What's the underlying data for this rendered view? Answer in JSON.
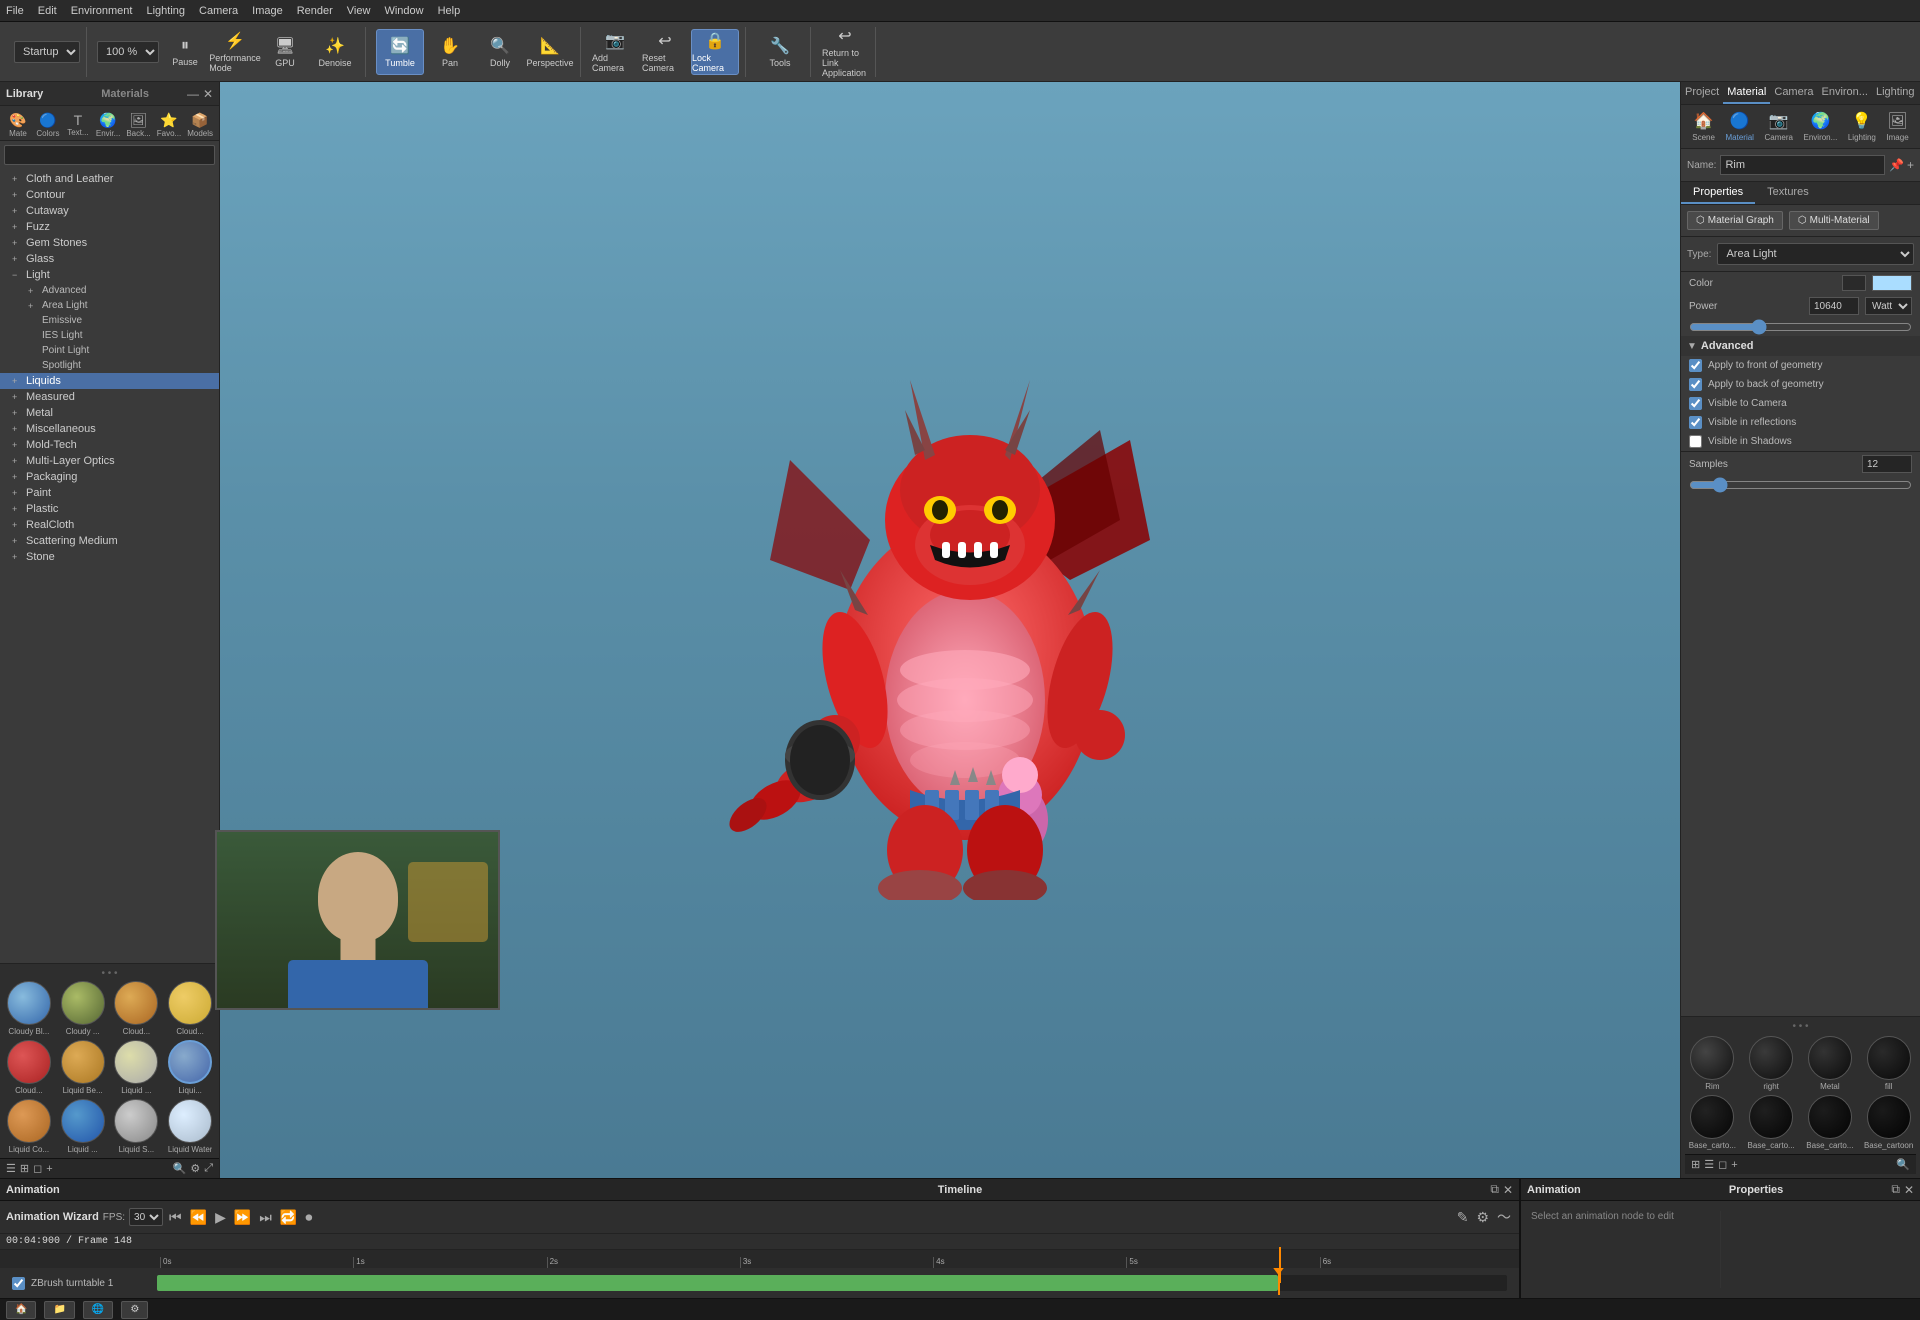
{
  "menubar": {
    "items": [
      "File",
      "Edit",
      "Environment",
      "Lighting",
      "Camera",
      "Image",
      "Render",
      "View",
      "Window",
      "Help"
    ]
  },
  "toolbar": {
    "startup_label": "Startup",
    "zoom_label": "100 %",
    "pause_label": "Pause",
    "performance_mode_label": "Performance Mode",
    "gpu_label": "GPU",
    "denoise_label": "Denoise",
    "tumble_label": "Tumble",
    "pan_label": "Pan",
    "dolly_label": "Dolly",
    "perspective_label": "Perspective",
    "add_camera_label": "Add Camera",
    "reset_camera_label": "Reset Camera",
    "lock_camera_label": "Lock Camera",
    "tools_label": "Tools",
    "return_application_label": "Return to Link Application"
  },
  "left_panel": {
    "title": "Library",
    "materials_tab": "Materials",
    "tab_items": [
      "Mate",
      "Colors",
      "Text...",
      "Envir...",
      "Back...",
      "Favo...",
      "Models"
    ],
    "search_placeholder": "",
    "tree": [
      {
        "label": "Cloth and Leather",
        "expanded": false,
        "indent": 0
      },
      {
        "label": "Contour",
        "expanded": false,
        "indent": 0
      },
      {
        "label": "Cutaway",
        "expanded": false,
        "indent": 0
      },
      {
        "label": "Fuzz",
        "expanded": false,
        "indent": 0
      },
      {
        "label": "Gem Stones",
        "expanded": false,
        "indent": 0
      },
      {
        "label": "Glass",
        "expanded": false,
        "indent": 0
      },
      {
        "label": "Light",
        "expanded": true,
        "indent": 0
      },
      {
        "label": "Advanced",
        "expanded": false,
        "indent": 1
      },
      {
        "label": "Area Light",
        "expanded": false,
        "indent": 1
      },
      {
        "label": "Emissive",
        "expanded": false,
        "indent": 1
      },
      {
        "label": "IES Light",
        "expanded": false,
        "indent": 1
      },
      {
        "label": "Point Light",
        "expanded": false,
        "indent": 1
      },
      {
        "label": "Spotlight",
        "expanded": false,
        "indent": 1
      },
      {
        "label": "Liquids",
        "expanded": false,
        "indent": 0,
        "selected": true
      },
      {
        "label": "Measured",
        "expanded": false,
        "indent": 0
      },
      {
        "label": "Metal",
        "expanded": false,
        "indent": 0
      },
      {
        "label": "Miscellaneous",
        "expanded": false,
        "indent": 0
      },
      {
        "label": "Mold-Tech",
        "expanded": false,
        "indent": 0
      },
      {
        "label": "Multi-Layer Optics",
        "expanded": false,
        "indent": 0
      },
      {
        "label": "Packaging",
        "expanded": false,
        "indent": 0
      },
      {
        "label": "Paint",
        "expanded": false,
        "indent": 0
      },
      {
        "label": "Plastic",
        "expanded": false,
        "indent": 0
      },
      {
        "label": "RealCloth",
        "expanded": false,
        "indent": 0
      },
      {
        "label": "Scattering Medium",
        "expanded": false,
        "indent": 0
      },
      {
        "label": "Stone",
        "expanded": false,
        "indent": 0
      }
    ],
    "swatches": [
      {
        "label": "Cloudy Bl...",
        "color": "#4488cc",
        "selected": false
      },
      {
        "label": "Cloudy ...",
        "color": "#88aa44",
        "selected": false
      },
      {
        "label": "Cloud...",
        "color": "#cc8833",
        "selected": false
      },
      {
        "label": "Cloud...",
        "color": "#ddbb55",
        "selected": false
      },
      {
        "label": "Cloud...",
        "color": "#cc3333",
        "selected": false
      },
      {
        "label": "Liquid Be...",
        "color": "#bb8833",
        "selected": false
      },
      {
        "label": "Liquid ...",
        "color": "#cccc88",
        "selected": false
      },
      {
        "label": "Liqui...",
        "color": "#6699bb",
        "selected": true
      },
      {
        "label": "Liquid Co...",
        "color": "#cc7733",
        "selected": false
      },
      {
        "label": "Liquid ...",
        "color": "#4488bb",
        "selected": false
      },
      {
        "label": "Liquid S...",
        "color": "#aaaaaa",
        "selected": false
      },
      {
        "label": "Liquid Water",
        "color": "#ccddee",
        "selected": false
      }
    ]
  },
  "right_panel": {
    "tabs": [
      "Project",
      "Material",
      "Camera",
      "Environ...",
      "Lighting",
      "Image"
    ],
    "active_tab": "Material",
    "mat_icons": [
      "Scene",
      "Material",
      "Camera",
      "Environ...",
      "Lighting",
      "Image"
    ],
    "name_label": "Name:",
    "name_value": "Rim",
    "sub_tabs": [
      "Properties",
      "Textures"
    ],
    "active_sub_tab": "Properties",
    "graph_btn": "Material Graph",
    "multi_btn": "Multi-Material",
    "type_label": "Type:",
    "type_value": "Area Light",
    "color_label": "Color",
    "color_value": "#aaddff",
    "power_label": "Power",
    "power_value": "10640",
    "power_unit": "Watt",
    "advanced_section": "Advanced",
    "apply_front": "Apply to front of geometry",
    "apply_back": "Apply to back of geometry",
    "visible_camera": "Visible to Camera",
    "visible_reflections": "Visible in reflections",
    "visible_shadows": "Visible in Shadows",
    "samples_label": "Samples",
    "samples_value": "12",
    "swatches": [
      {
        "label": "Rim",
        "color": "#222222"
      },
      {
        "label": "right",
        "color": "#1a1a1a"
      },
      {
        "label": "Metal",
        "color": "#111111"
      },
      {
        "label": "fill",
        "color": "#0a0a0a"
      },
      {
        "label": "Base_carto...",
        "color": "#0f0f0f"
      },
      {
        "label": "Base_carto...",
        "color": "#0d0d0d"
      },
      {
        "label": "Base_carto...",
        "color": "#0c0c0c"
      },
      {
        "label": "Base_cartoon",
        "color": "#0b0b0b"
      }
    ]
  },
  "animation": {
    "title": "Animation",
    "wizard_label": "Animation Wizard",
    "fps_label": "FPS:",
    "fps_value": "30",
    "time_display": "00:04:900 / Frame 148",
    "track_label": "ZBrush turntable 1",
    "timeline_title": "Timeline",
    "anim_right_title": "Animation",
    "anim_right_desc": "Select an animation node to edit",
    "anim_properties_title": "Properties"
  },
  "taskbar": {
    "items": []
  }
}
